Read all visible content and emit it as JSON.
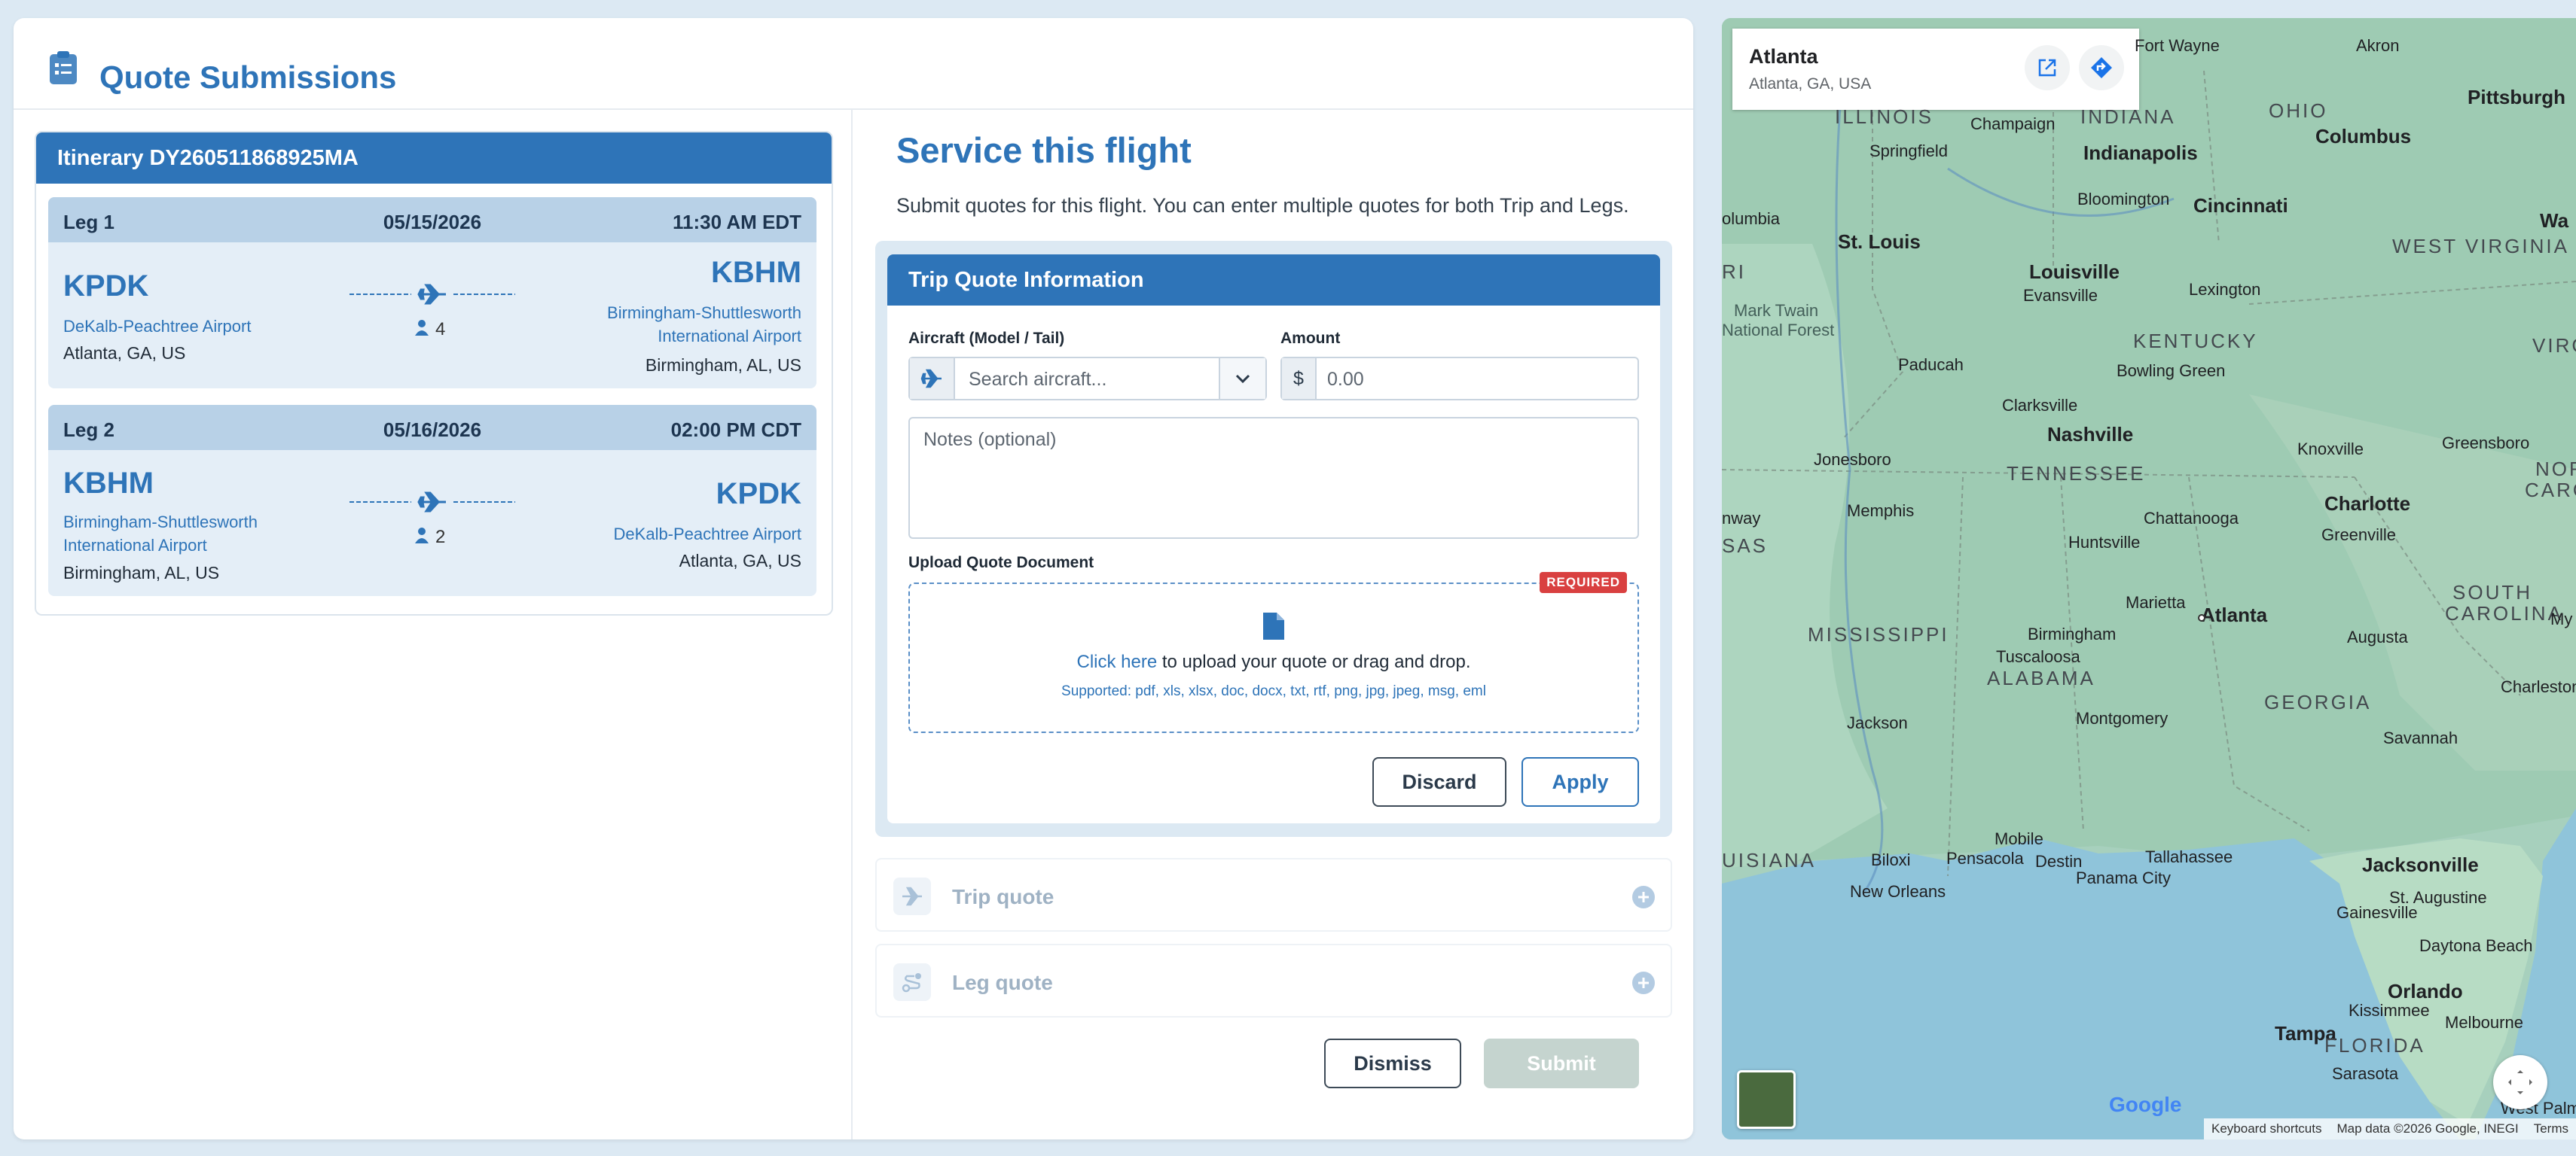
{
  "page": {
    "title": "Quote Submissions"
  },
  "itinerary": {
    "header": "Itinerary DY260511868925MA",
    "legs": [
      {
        "name": "Leg 1",
        "date": "05/15/2026",
        "time": "11:30 AM EDT",
        "from_code": "KPDK",
        "from_airport": "DeKalb-Peachtree Airport",
        "from_city": "Atlanta, GA, US",
        "to_code": "KBHM",
        "to_airport_line1": "Birmingham-Shuttlesworth",
        "to_airport_line2": "International Airport",
        "to_city": "Birmingham, AL, US",
        "pax": "4"
      },
      {
        "name": "Leg 2",
        "date": "05/16/2026",
        "time": "02:00 PM CDT",
        "from_code": "KBHM",
        "from_airport_line1": "Birmingham-Shuttlesworth",
        "from_airport_line2": "International Airport",
        "from_city": "Birmingham, AL, US",
        "to_code": "KPDK",
        "to_airport": "DeKalb-Peachtree Airport",
        "to_city": "Atlanta, GA, US",
        "pax": "2"
      }
    ]
  },
  "service": {
    "title": "Service this flight",
    "subtitle": "Submit quotes for this flight. You can enter multiple quotes for both Trip and Legs."
  },
  "trip_form": {
    "header": "Trip Quote Information",
    "aircraft_label": "Aircraft (Model / Tail)",
    "aircraft_placeholder": "Search aircraft...",
    "amount_label": "Amount",
    "currency": "$",
    "amount_placeholder": "0.00",
    "notes_placeholder": "Notes (optional)",
    "upload_label": "Upload Quote Document",
    "required_badge": "REQUIRED",
    "upload_link": "Click here",
    "upload_text": " to upload your quote or drag and drop.",
    "upload_supported": "Supported: pdf, xls, xlsx, doc, docx, txt, rtf, png, jpg, jpeg, msg, eml",
    "discard_label": "Discard",
    "apply_label": "Apply"
  },
  "sections": {
    "trip_quote": "Trip quote",
    "leg_quote": "Leg quote"
  },
  "footer_actions": {
    "dismiss": "Dismiss",
    "submit": "Submit"
  },
  "map": {
    "place_title": "Atlanta",
    "place_subtitle": "Atlanta, GA, USA",
    "footer": [
      "Keyboard shortcuts",
      "Map data ©2026 Google, INEGI",
      "Terms"
    ],
    "logo": "Google",
    "labels": {
      "fort_wayne": "Fort Wayne",
      "akron": "Akron",
      "pittsburgh": "Pittsburgh",
      "illinois": "ILLINOIS",
      "indiana": "INDIANA",
      "ohio": "OHIO",
      "champaign": "Champaign",
      "columbus": "Columbus",
      "springfield": "Springfield",
      "indianapolis": "Indianapolis",
      "columbia": "olumbia",
      "bloomington": "Bloomington",
      "cincinnati": "Cincinnati",
      "wa": "Wa",
      "st_louis": "St. Louis",
      "west_virginia": "WEST VIRGINIA",
      "louisville": "Louisville",
      "evansville": "Evansville",
      "lexington": "Lexington",
      "ri": "RI",
      "mark_twain": "Mark Twain",
      "national_forest": "National Forest",
      "kentucky": "KENTUCKY",
      "virgin": "VIRGIN",
      "paducah": "Paducah",
      "bowling_green": "Bowling Green",
      "clarksville": "Clarksville",
      "nashville": "Nashville",
      "knoxville": "Knoxville",
      "greensboro": "Greensboro",
      "jonesboro": "Jonesboro",
      "tennessee": "TENNESSEE",
      "north": "NORTH",
      "carolin": "CAROLIN",
      "charlotte": "Charlotte",
      "memphis": "Memphis",
      "chattanooga": "Chattanooga",
      "greenville": "Greenville",
      "nway": "nway",
      "sas": "SAS",
      "huntsville": "Huntsville",
      "south": "SOUTH",
      "carolina": "CAROLINA",
      "marietta": "Marietta",
      "atlanta": "Atlanta",
      "mississippi": "MISSISSIPPI",
      "birmingham": "Birmingham",
      "augusta": "Augusta",
      "my": "My",
      "tuscaloosa": "Tuscaloosa",
      "alabama": "ALABAMA",
      "georgia": "GEORGIA",
      "charleston": "Charleston",
      "jackson": "Jackson",
      "montgomery": "Montgomery",
      "savannah": "Savannah",
      "mobile": "Mobile",
      "uisiana": "UISIANA",
      "biloxi": "Biloxi",
      "pensacola": "Pensacola",
      "destin": "Destin",
      "tallahassee": "Tallahassee",
      "jacksonville": "Jacksonville",
      "new_orleans": "New Orleans",
      "panama_city": "Panama City",
      "st_augustine": "St. Augustine",
      "gainesville": "Gainesville",
      "daytona": "Daytona Beach",
      "orlando": "Orlando",
      "kissimmee": "Kissimmee",
      "melbourne": "Melbourne",
      "tampa": "Tampa",
      "florida": "FLORIDA",
      "sarasota": "Sarasota",
      "west_palm": "West Palm"
    }
  }
}
